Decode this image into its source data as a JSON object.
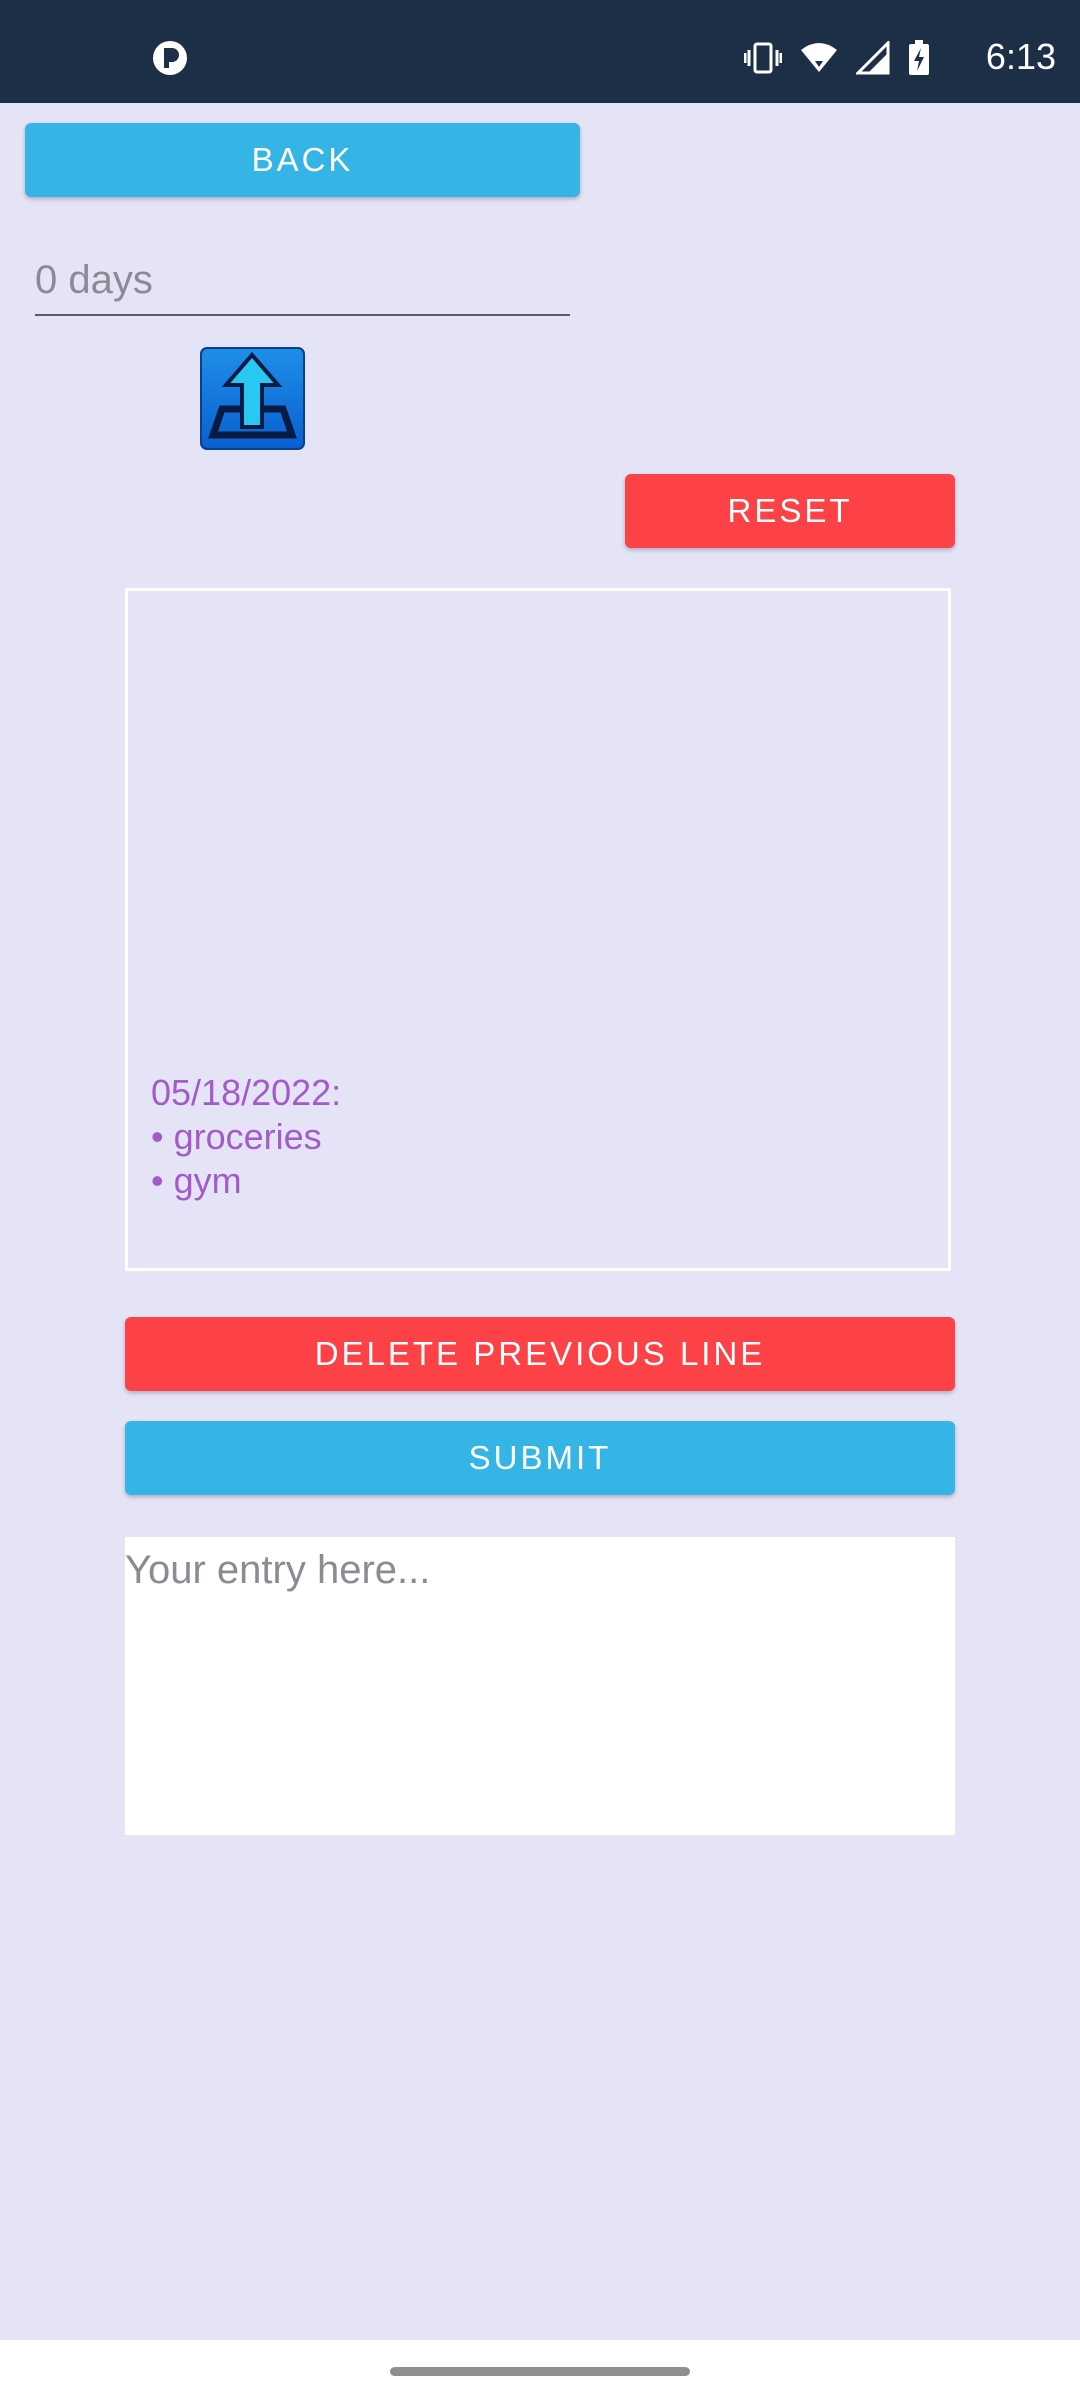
{
  "status_bar": {
    "time": "6:13",
    "icons": [
      "app-icon",
      "vibrate-icon",
      "wifi-icon",
      "signal-icon",
      "battery-charging-icon"
    ]
  },
  "buttons": {
    "back": "BACK",
    "reset": "RESET",
    "delete_previous_line": "DELETE PREVIOUS LINE",
    "submit": "SUBMIT"
  },
  "days_field": {
    "value": "0 days"
  },
  "upload_icon": "upload-icon",
  "log": {
    "lines": [
      "05/18/2022:",
      "• groceries",
      "• gym"
    ]
  },
  "entry": {
    "placeholder": "Your entry here..."
  },
  "colors": {
    "status_bar": "#1c2f47",
    "background": "#e5e4f7",
    "blue_button": "#35b4e6",
    "red_button": "#fd4247",
    "log_text": "#a35bc9"
  }
}
